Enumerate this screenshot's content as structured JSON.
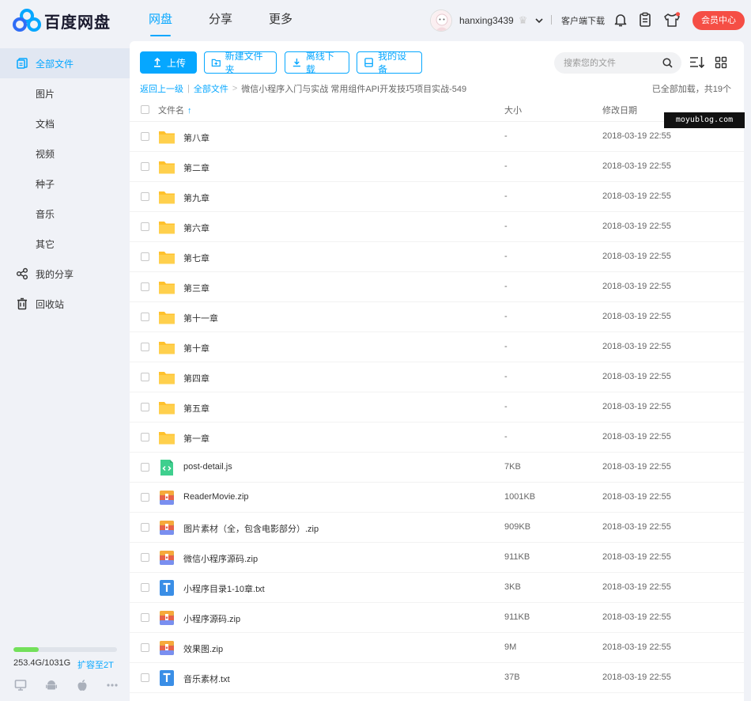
{
  "brand": {
    "name": "百度网盘"
  },
  "nav": {
    "items": [
      "网盘",
      "分享",
      "更多"
    ]
  },
  "user": {
    "name": "hanxing3439"
  },
  "header": {
    "client_download": "客户端下载",
    "vip_button": "会员中心"
  },
  "sidebar": {
    "items": [
      {
        "label": "全部文件",
        "icon": "all-files-icon"
      },
      {
        "label": "图片"
      },
      {
        "label": "文档"
      },
      {
        "label": "视频"
      },
      {
        "label": "种子"
      },
      {
        "label": "音乐"
      },
      {
        "label": "其它"
      },
      {
        "label": "我的分享",
        "icon": "share-icon"
      },
      {
        "label": "回收站",
        "icon": "trash-icon"
      }
    ],
    "quota": {
      "text": "253.4G/1031G",
      "expand": "扩容至2T",
      "used_fraction": 0.2458
    }
  },
  "toolbar": {
    "upload": "上传",
    "new_folder": "新建文件夹",
    "offline_download": "离线下载",
    "my_devices": "我的设备",
    "search_placeholder": "搜索您的文件"
  },
  "breadcrumb": {
    "back": "返回上一级",
    "root": "全部文件",
    "current": "微信小程序入门与实战 常用组件API开发技巧项目实战-549",
    "loaded": "已全部加载，共19个"
  },
  "table": {
    "headers": {
      "name": "文件名",
      "size": "大小",
      "date": "修改日期"
    },
    "rows": [
      {
        "name": "第八章",
        "size": "-",
        "date": "2018-03-19 22:55",
        "type": "folder"
      },
      {
        "name": "第二章",
        "size": "-",
        "date": "2018-03-19 22:55",
        "type": "folder"
      },
      {
        "name": "第九章",
        "size": "-",
        "date": "2018-03-19 22:55",
        "type": "folder"
      },
      {
        "name": "第六章",
        "size": "-",
        "date": "2018-03-19 22:55",
        "type": "folder"
      },
      {
        "name": "第七章",
        "size": "-",
        "date": "2018-03-19 22:55",
        "type": "folder"
      },
      {
        "name": "第三章",
        "size": "-",
        "date": "2018-03-19 22:55",
        "type": "folder"
      },
      {
        "name": "第十一章",
        "size": "-",
        "date": "2018-03-19 22:55",
        "type": "folder"
      },
      {
        "name": "第十章",
        "size": "-",
        "date": "2018-03-19 22:55",
        "type": "folder"
      },
      {
        "name": "第四章",
        "size": "-",
        "date": "2018-03-19 22:55",
        "type": "folder"
      },
      {
        "name": "第五章",
        "size": "-",
        "date": "2018-03-19 22:55",
        "type": "folder"
      },
      {
        "name": "第一章",
        "size": "-",
        "date": "2018-03-19 22:55",
        "type": "folder"
      },
      {
        "name": "post-detail.js",
        "size": "7KB",
        "date": "2018-03-19 22:55",
        "type": "code"
      },
      {
        "name": "ReaderMovie.zip",
        "size": "1001KB",
        "date": "2018-03-19 22:55",
        "type": "zip"
      },
      {
        "name": "图片素材（全，包含电影部分）.zip",
        "size": "909KB",
        "date": "2018-03-19 22:55",
        "type": "zip"
      },
      {
        "name": "微信小程序源码.zip",
        "size": "911KB",
        "date": "2018-03-19 22:55",
        "type": "zip"
      },
      {
        "name": "小程序目录1-10章.txt",
        "size": "3KB",
        "date": "2018-03-19 22:55",
        "type": "txt"
      },
      {
        "name": "小程序源码.zip",
        "size": "911KB",
        "date": "2018-03-19 22:55",
        "type": "zip"
      },
      {
        "name": "效果图.zip",
        "size": "9M",
        "date": "2018-03-19 22:55",
        "type": "zip"
      },
      {
        "name": "音乐素材.txt",
        "size": "37B",
        "date": "2018-03-19 22:55",
        "type": "txt"
      }
    ]
  },
  "watermark": "moyublog.com",
  "colors": {
    "accent": "#06a7ff",
    "vip": "#f54e45",
    "folder": "#ffc12c",
    "quota": "#73e05a"
  }
}
